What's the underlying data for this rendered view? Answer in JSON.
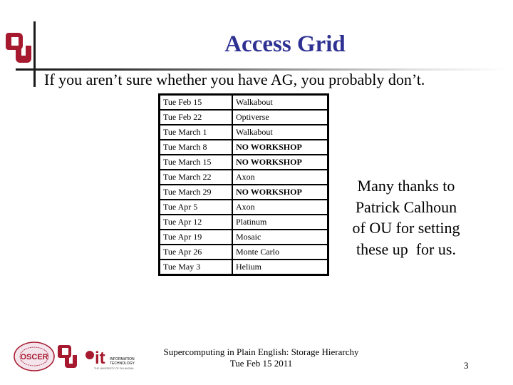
{
  "slide": {
    "title": "Access Grid",
    "subtitle": "If you aren’t sure whether you have AG, you probably don’t.",
    "title_color": "#2e3192",
    "brand_color": "#a6192e"
  },
  "schedule": [
    {
      "date": "Tue Feb 15",
      "event": "Walkabout",
      "bold": false
    },
    {
      "date": "Tue Feb 22",
      "event": "Optiverse",
      "bold": false
    },
    {
      "date": "Tue March 1",
      "event": "Walkabout",
      "bold": false
    },
    {
      "date": "Tue March 8",
      "event": "NO WORKSHOP",
      "bold": true
    },
    {
      "date": "Tue March 15",
      "event": "NO WORKSHOP",
      "bold": true
    },
    {
      "date": "Tue March 22",
      "event": "Axon",
      "bold": false
    },
    {
      "date": "Tue March 29",
      "event": "NO WORKSHOP",
      "bold": true
    },
    {
      "date": "Tue Apr 5",
      "event": "Axon",
      "bold": false
    },
    {
      "date": "Tue Apr 12",
      "event": "Platinum",
      "bold": false
    },
    {
      "date": "Tue Apr 19",
      "event": "Mosaic",
      "bold": false
    },
    {
      "date": "Tue Apr 26",
      "event": "Monte Carlo",
      "bold": false
    },
    {
      "date": "Tue May 3",
      "event": "Helium",
      "bold": false
    }
  ],
  "thanks": {
    "lines": [
      "Many thanks to",
      "Patrick Calhoun",
      "of OU for setting",
      "these up  for us."
    ]
  },
  "footer": {
    "line1": "Supercomputing in Plain English: Storage Hierarchy",
    "line2": "Tue Feb 15 2011",
    "page_number": "3"
  },
  "logos": {
    "oscer": "OSCER",
    "it_big": "it",
    "it_line1": "INFORMATION",
    "it_line2": "TECHNOLOGY",
    "it_line3": "THE UNIVERSITY OF OKLAHOMA"
  }
}
